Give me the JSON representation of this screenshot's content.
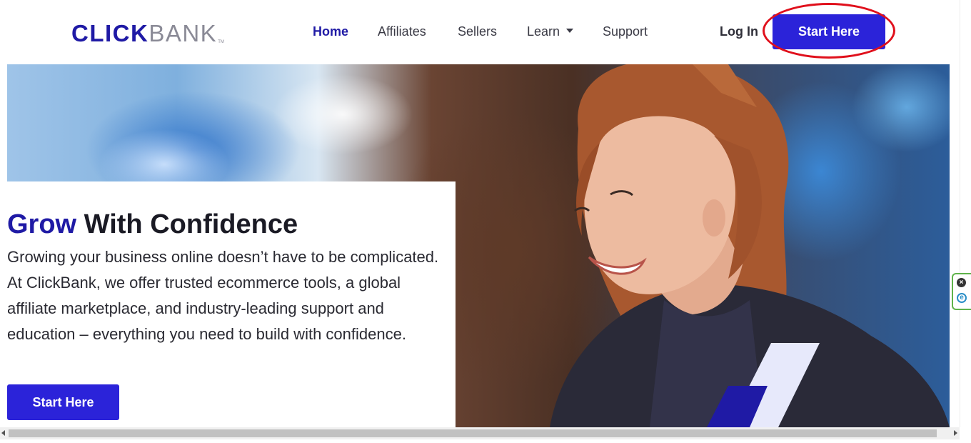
{
  "header": {
    "logo": {
      "part1": "CLICK",
      "part2": "BANK",
      "tm": "TM"
    },
    "nav": [
      {
        "label": "Home",
        "active": true
      },
      {
        "label": "Affiliates",
        "active": false
      },
      {
        "label": "Sellers",
        "active": false
      },
      {
        "label": "Learn",
        "active": false,
        "dropdown": true
      },
      {
        "label": "Support",
        "active": false
      }
    ],
    "login_label": "Log In",
    "cta_label": "Start Here"
  },
  "hero": {
    "headline_strong": "Grow",
    "headline_rest": " With Confidence",
    "body": "Growing your business online doesn’t have to be complicated. At ClickBank, we offer trusted ecommerce tools, a global affiliate marketplace, and industry-leading support and education – everything you need to build with confidence.",
    "cta_label": "Start Here"
  },
  "colors": {
    "brand": "#1f1aa5",
    "button": "#2b23d9",
    "annotation": "#e0101c"
  },
  "side_widget": {
    "close_icon": "close-icon",
    "extension_icon": "e-icon"
  }
}
